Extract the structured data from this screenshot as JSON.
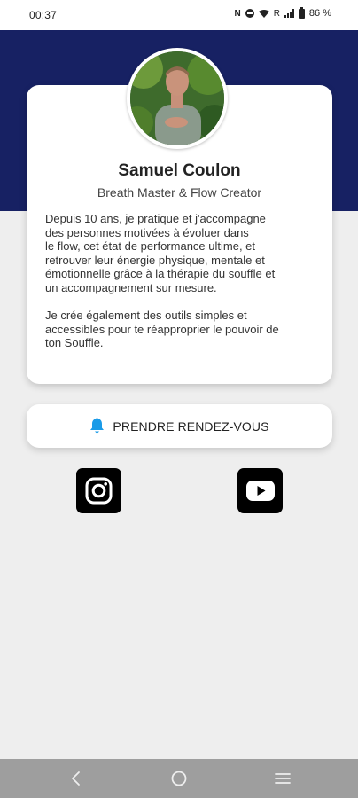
{
  "status_bar": {
    "time": "00:37",
    "nfc": "N",
    "roaming": "R",
    "battery": "86 %"
  },
  "profile": {
    "name": "Samuel Coulon",
    "title": "Breath Master & Flow Creator",
    "bio_lines_p1": [
      "Depuis 10 ans, je pratique et j'accompagne",
      "des personnes motivées à évoluer dans",
      "le flow, cet état de performance ultime, et",
      "retrouver leur énergie physique, mentale et",
      "émotionnelle grâce à la thérapie du souffle et",
      "un accompagnement sur mesure."
    ],
    "bio_lines_p2": [
      "Je crée également des outils simples et",
      "accessibles pour te réapproprier le pouvoir de",
      "ton Souffle."
    ]
  },
  "appointment": {
    "label": "PRENDRE RENDEZ-VOUS",
    "icon": "bell-icon",
    "icon_color": "#1a9be8"
  },
  "social": {
    "instagram_icon": "instagram-icon",
    "youtube_icon": "youtube-icon"
  },
  "colors": {
    "header": "#172163",
    "background": "#eeeeee",
    "card": "#ffffff",
    "nav_bar": "#9e9e9e"
  },
  "nav": {
    "back_icon": "chevron-left-icon",
    "home_icon": "circle-home-icon",
    "recents_icon": "menu-lines-icon"
  }
}
